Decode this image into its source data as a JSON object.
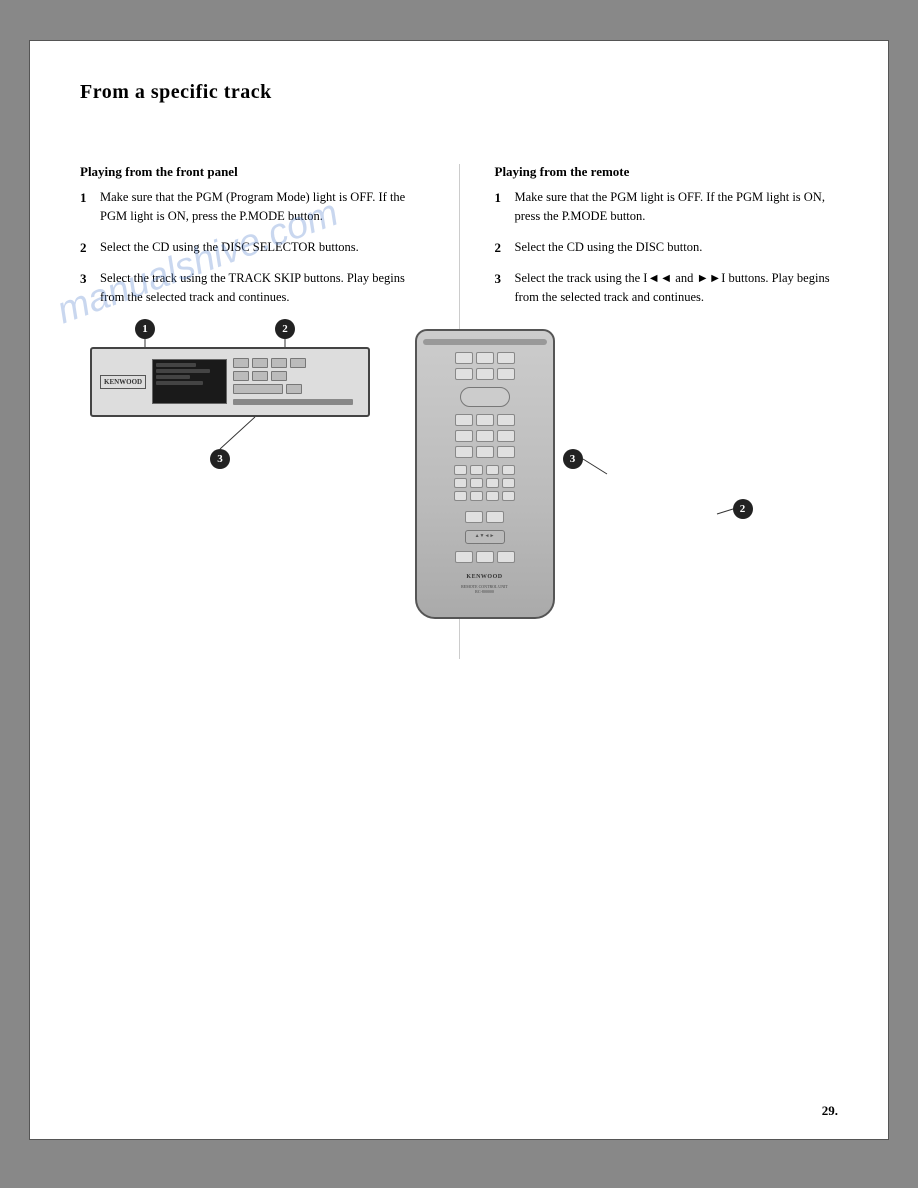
{
  "page": {
    "title": "From a specific track",
    "page_number": "29.",
    "watermark": "manualshive.com"
  },
  "left_col": {
    "heading": "Playing from the front panel",
    "steps": [
      {
        "num": "1",
        "text": "Make sure that the PGM (Program Mode) light is OFF. If the PGM light is ON, press the P.MODE button."
      },
      {
        "num": "2",
        "text": "Select the CD using the DISC SELECTOR buttons."
      },
      {
        "num": "3",
        "text": "Select the track using the TRACK SKIP buttons. Play begins from the selected track and continues."
      }
    ],
    "bubble1_label": "1",
    "bubble2_label": "2",
    "bubble3_label": "3"
  },
  "right_col": {
    "heading": "Playing from the remote",
    "steps": [
      {
        "num": "1",
        "text": "Make sure that the PGM light is OFF. If the PGM light is ON, press the P.MODE button."
      },
      {
        "num": "2",
        "text": "Select the CD using the DISC button."
      },
      {
        "num": "3",
        "text": "Select the track using the I◄◄ and ►►I buttons. Play begins from the selected track and continues."
      }
    ],
    "bubble2_label": "2",
    "bubble3_label": "3",
    "remote_brand": "KENWOOD",
    "remote_subtitle": "REMOTE CONTROL UNIT\nRC-800000"
  }
}
